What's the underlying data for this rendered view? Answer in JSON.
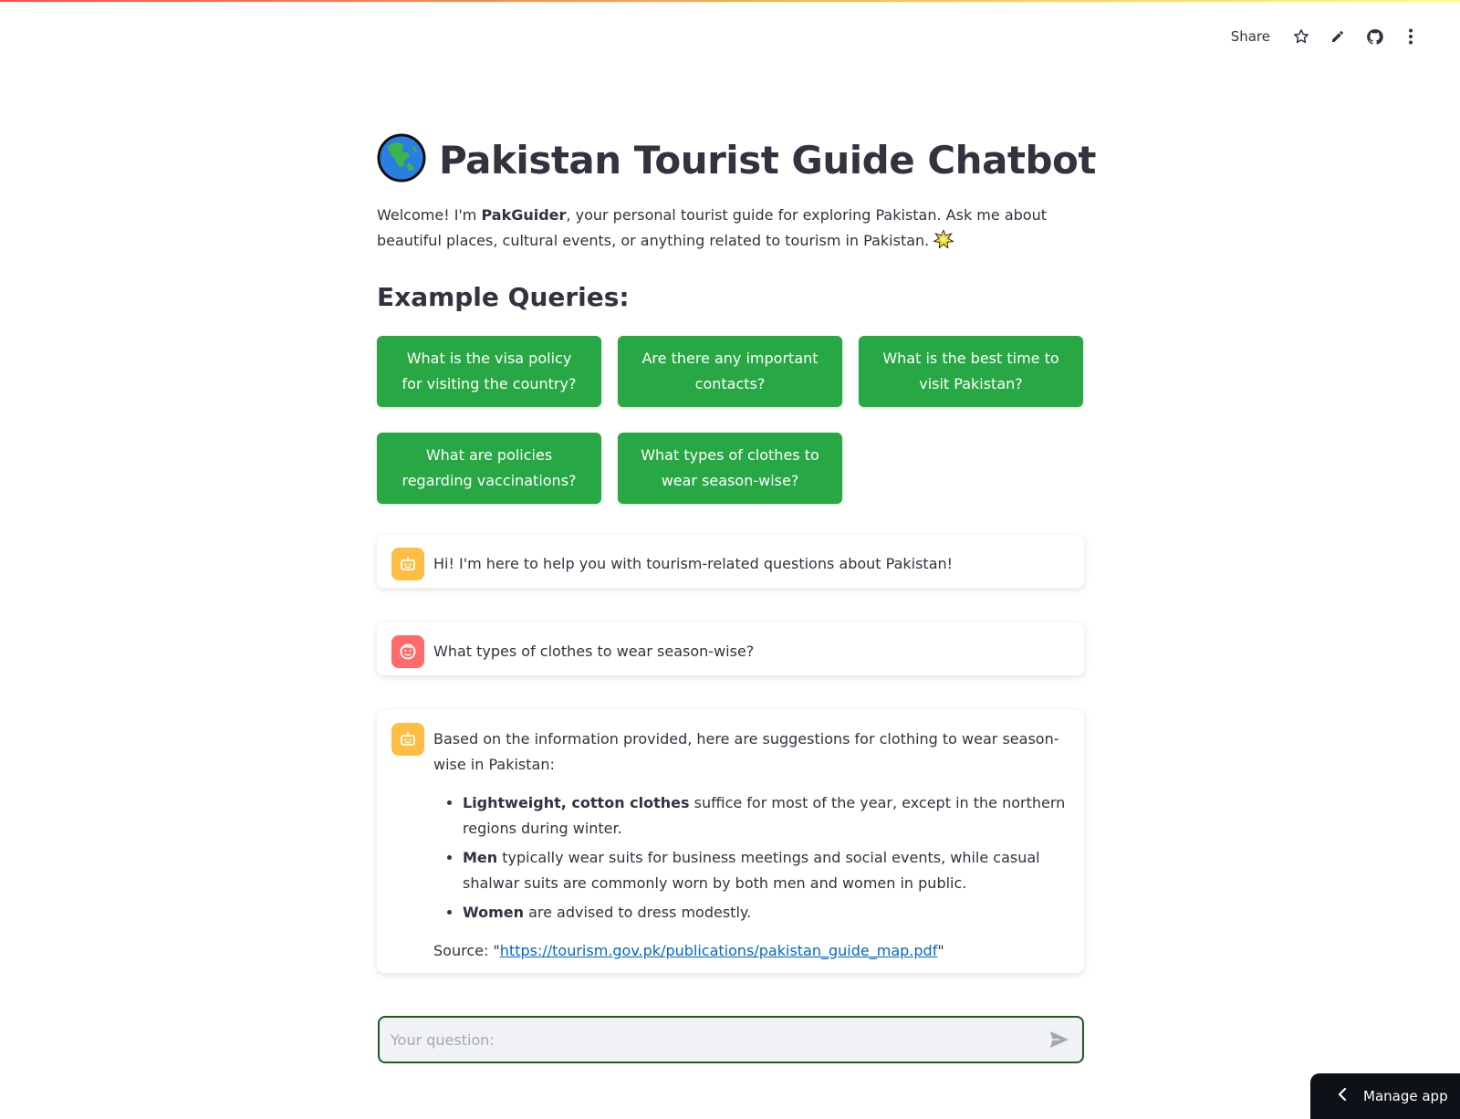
{
  "toolbar": {
    "share_label": "Share",
    "icons": [
      "star-icon",
      "pencil-icon",
      "github-icon",
      "more-vertical-icon"
    ]
  },
  "header": {
    "globe_icon": "globe-asia-icon",
    "title": "Pakistan Tourist Guide Chatbot"
  },
  "intro": {
    "prefix": "Welcome! I'm ",
    "bot_name": "PakGuider",
    "suffix": ", your personal tourist guide for exploring Pakistan. Ask me about beautiful places, cultural events, or anything related to tourism in Pakistan.",
    "emoji_icon": "sparkle-star-icon"
  },
  "examples": {
    "heading": "Example Queries:",
    "buttons": [
      "What is the visa policy for visiting the country?",
      "Are there any important contacts?",
      "What is the best time to visit Pakistan?",
      "What are policies regarding vaccinations?",
      "What types of clothes to wear season-wise?"
    ]
  },
  "chat": {
    "messages": [
      {
        "role": "assistant",
        "avatar_icon": "robot-icon",
        "text": "Hi! I'm here to help you with tourism-related questions about Pakistan!"
      },
      {
        "role": "user",
        "avatar_icon": "user-face-icon",
        "text": "What types of clothes to wear season-wise?"
      },
      {
        "role": "assistant",
        "avatar_icon": "robot-icon",
        "intro": "Based on the information provided, here are suggestions for clothing to wear season-wise in Pakistan:",
        "bullets": [
          {
            "bold": "Lightweight, cotton clothes",
            "rest": " suffice for most of the year, except in the northern regions during winter."
          },
          {
            "bold": "Men",
            "rest": " typically wear suits for business meetings and social events, while casual shalwar suits are commonly worn by both men and women in public."
          },
          {
            "bold": "Women",
            "rest": " are advised to dress modestly."
          }
        ],
        "source_prefix": "Source: \"",
        "source_link": "https://tourism.gov.pk/publications/pakistan_guide_map.pdf",
        "source_suffix": "\""
      }
    ]
  },
  "input": {
    "placeholder": "Your question:",
    "value": "",
    "send_icon": "send-icon"
  },
  "manage_app": {
    "label": "Manage app",
    "icon": "chevron-left-icon"
  },
  "colors": {
    "button_green": "#28a745",
    "bot_avatar": "#ffbd45",
    "user_avatar": "#ff6b6b",
    "link": "#0068c9",
    "input_border": "#1b5e20"
  }
}
